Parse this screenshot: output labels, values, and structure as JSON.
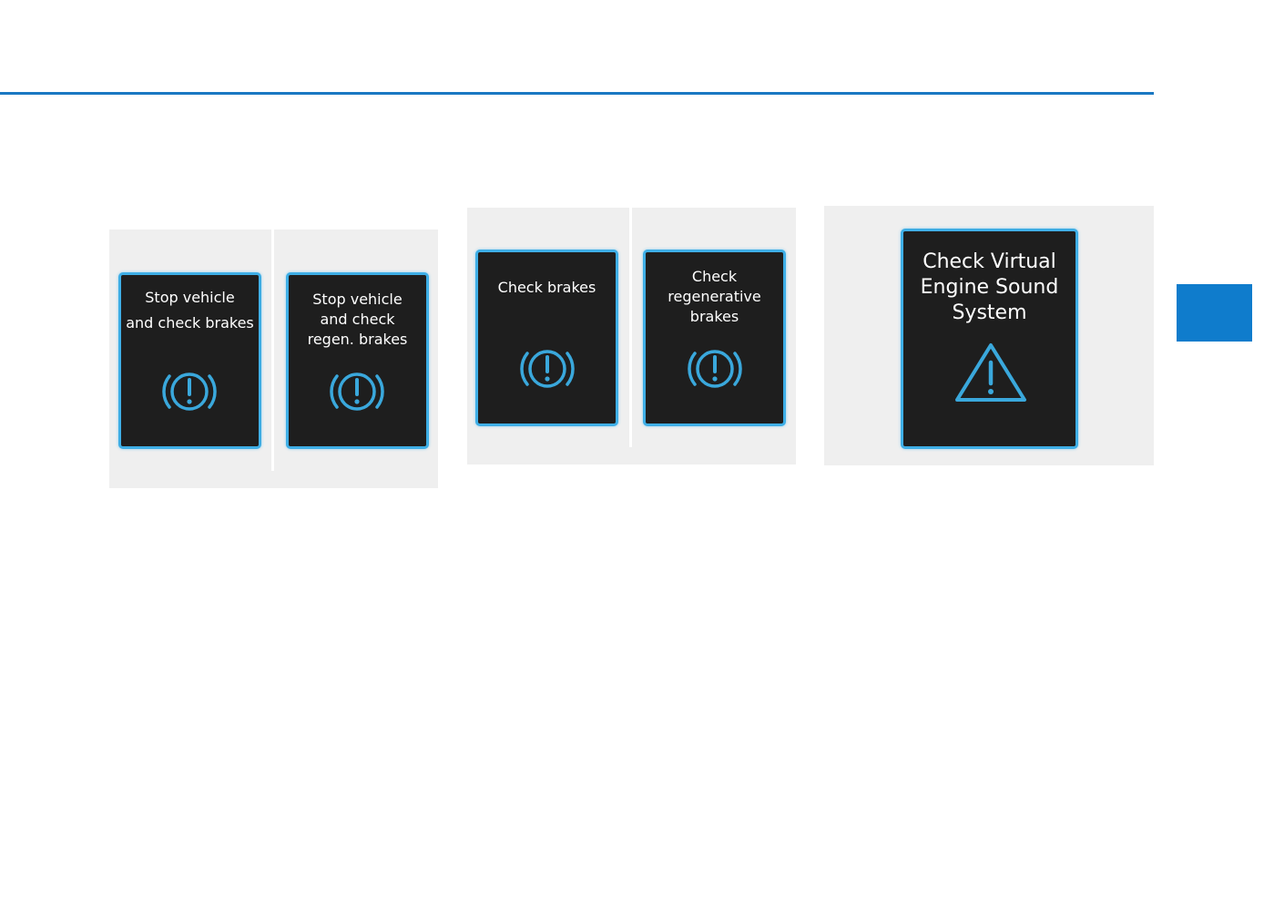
{
  "colors": {
    "accent_blue": "#1a78c2",
    "tab_blue": "#0f7ccc",
    "screen_bg": "#1e1e1e",
    "screen_border": "#3eaee6",
    "icon_blue": "#3aa8dc",
    "panel_bg": "#efefef"
  },
  "panels": [
    {
      "screens": [
        {
          "text": "Stop vehicle\nand check brakes",
          "icon": "brake-warning-icon"
        },
        {
          "text": "Stop vehicle\nand check\nregen. brakes",
          "icon": "brake-warning-icon"
        }
      ]
    },
    {
      "screens": [
        {
          "text": "Check brakes",
          "icon": "brake-warning-icon"
        },
        {
          "text": "Check\nregenerative\nbrakes",
          "icon": "brake-warning-icon"
        }
      ]
    },
    {
      "screens": [
        {
          "text": "Check Virtual\nEngine Sound\nSystem",
          "icon": "warning-triangle-icon"
        }
      ]
    }
  ]
}
